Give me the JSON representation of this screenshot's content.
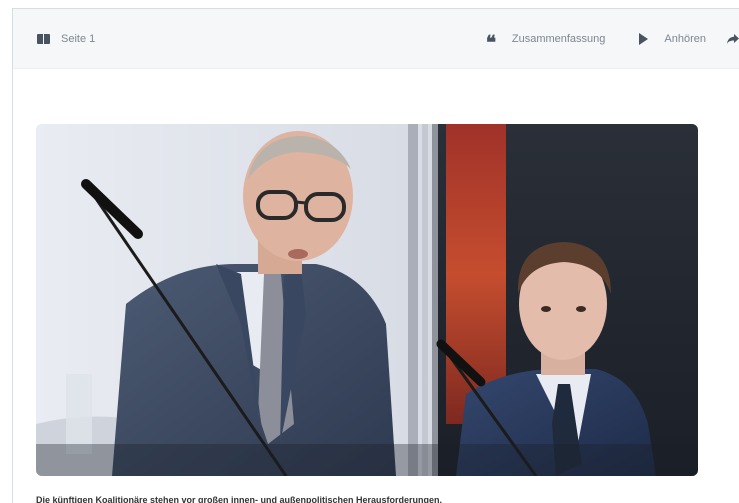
{
  "toolbar": {
    "page_label": "Seite 1",
    "summary_label": "Zusammenfassung",
    "listen_label": "Anhören",
    "icons": {
      "page": "book-icon",
      "summary": "quote-icon",
      "listen": "play-icon",
      "share": "share-arrow-icon"
    }
  },
  "article": {
    "photo": "two-men-at-microphones-press-conference",
    "caption": "Die künftigen Koalitionäre stehen vor großen innen- und außenpolitischen Herausforderungen."
  },
  "colors": {
    "toolbar_bg": "#f6f7f9",
    "icon": "#4a5461",
    "label": "#7d8792"
  }
}
